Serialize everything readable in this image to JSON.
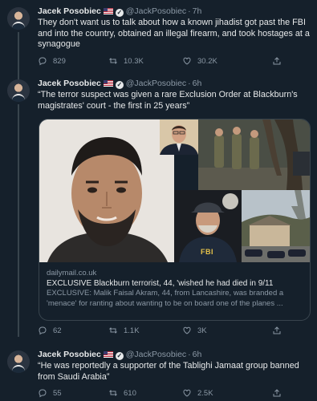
{
  "tweets": [
    {
      "author": "Jacek Posobiec",
      "handle": "@JackPosobiec",
      "time": "7h",
      "text": "They don't want us to talk about how a known jihadist got past the FBI and into the country, obtained an illegal firearm, and took hostages at a synagogue",
      "replies": "829",
      "retweets": "10.3K",
      "likes": "30.2K"
    },
    {
      "author": "Jacek Posobiec",
      "handle": "@JackPosobiec",
      "time": "6h",
      "text": "“The terror suspect was given a rare Exclusion Order at Blackburn's magistrates' court - the first in 25 years”",
      "card": {
        "domain": "dailymail.co.uk",
        "title": "EXCLUSIVE Blackburn terrorist, 44, 'wished he had died in 9/11",
        "description": "EXCLUSIVE: Malik Faisal Akram, 44, from Lancashire, was branded a 'menace' for ranting about wanting to be on board one of the planes ...",
        "badge_text": "FBI"
      },
      "replies": "62",
      "retweets": "1.1K",
      "likes": "3K"
    },
    {
      "author": "Jacek Posobiec",
      "handle": "@JackPosobiec",
      "time": "6h",
      "text": "“He was reportedly a supporter of the Tablighi Jamaat group banned from Saudi Arabia”",
      "replies": "55",
      "retweets": "610",
      "likes": "2.5K"
    }
  ],
  "icons": {
    "reply": "reply-icon",
    "retweet": "retweet-icon",
    "like": "like-icon",
    "share": "share-icon",
    "verified": "verified-badge-icon",
    "flag": "us-flag-icon"
  },
  "colors": {
    "background": "#15202b",
    "text": "#e7e9ea",
    "muted": "#8b98a5",
    "border": "#38444d"
  }
}
